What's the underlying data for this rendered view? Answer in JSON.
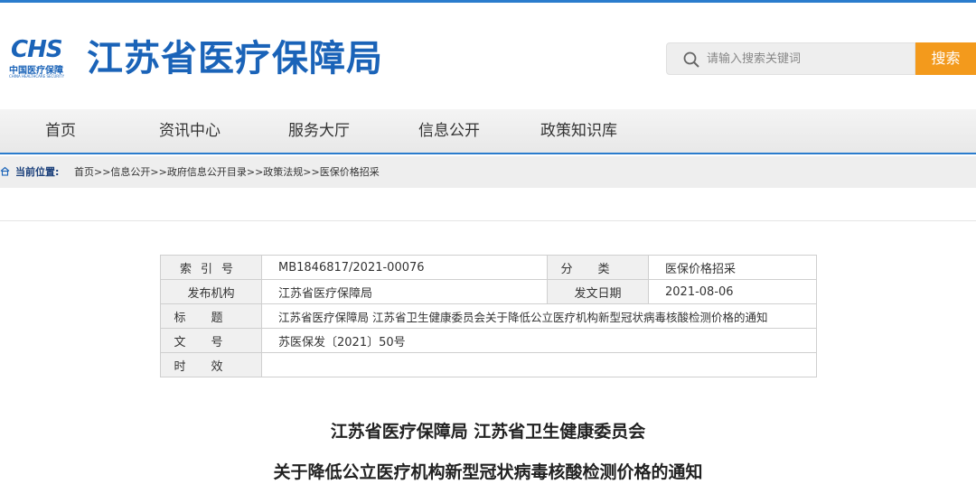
{
  "header": {
    "logo_mark": "CHS",
    "logo_cn": "中国医疗保障",
    "logo_en": "CHINA HEALTHCARE SECURITY",
    "site_title": "江苏省医疗保障局",
    "search_placeholder": "请输入搜索关键词",
    "search_button": "搜索",
    "accent_color": "#1a63b8",
    "search_button_color": "#f39a1c"
  },
  "nav": {
    "items": [
      {
        "label": "首页"
      },
      {
        "label": "资讯中心"
      },
      {
        "label": "服务大厅"
      },
      {
        "label": "信息公开"
      },
      {
        "label": "政策知识库"
      }
    ]
  },
  "breadcrumb": {
    "label": "当前位置:",
    "path": "首页>>信息公开>>政府信息公开目录>>政策法规>>医保价格招采"
  },
  "meta": {
    "index_label": "索引号",
    "index_value": "MB1846817/2021-00076",
    "category_label": "分类",
    "category_value": "医保价格招采",
    "publisher_label": "发布机构",
    "publisher_value": "江苏省医疗保障局",
    "date_label": "发文日期",
    "date_value": "2021-08-06",
    "title_label": "标题",
    "title_value": "江苏省医疗保障局 江苏省卫生健康委员会关于降低公立医疗机构新型冠状病毒核酸检测价格的通知",
    "docno_label": "文号",
    "docno_value": "苏医保发〔2021〕50号",
    "validity_label": "时效",
    "validity_value": ""
  },
  "document": {
    "title_line1": "江苏省医疗保障局 江苏省卫生健康委员会",
    "title_line2": "关于降低公立医疗机构新型冠状病毒核酸检测价格的通知"
  }
}
